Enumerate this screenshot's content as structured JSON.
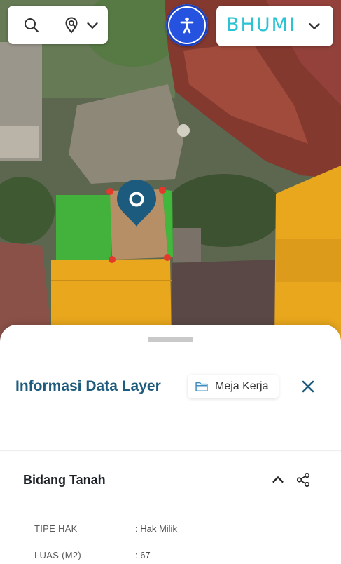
{
  "map": {
    "search_icon": "search-icon",
    "location_search_icon": "location-search-icon",
    "dropdown_icon": "chevron-down-icon",
    "accessibility_icon": "accessibility-icon",
    "accessibility_color": "#2553e0",
    "pin_icon": "map-pin-icon",
    "pin_color": "#1c5a7e",
    "parcel_colors": {
      "selected": "#b78f67",
      "neighbor_green": "#41b83c",
      "neighbor_orange": "#e9a71d",
      "vertex": "#e2392d"
    }
  },
  "brand": {
    "logo_text": "BHUMI",
    "color": "#2ac3d3",
    "menu_icon": "chevron-down-icon"
  },
  "panel": {
    "title": "Informasi Data Layer",
    "title_color": "#1e5b7c",
    "workspace_button": {
      "label": "Meja Kerja",
      "icon": "folder-icon"
    },
    "close_icon": "close-icon",
    "section": {
      "title": "Bidang Tanah",
      "collapse_icon": "chevron-up-icon",
      "share_icon": "share-icon",
      "rows": [
        {
          "label": "TIPE HAK",
          "value": ": Hak Milik"
        },
        {
          "label": "LUAS (M2)",
          "value": ": 67"
        }
      ]
    }
  }
}
